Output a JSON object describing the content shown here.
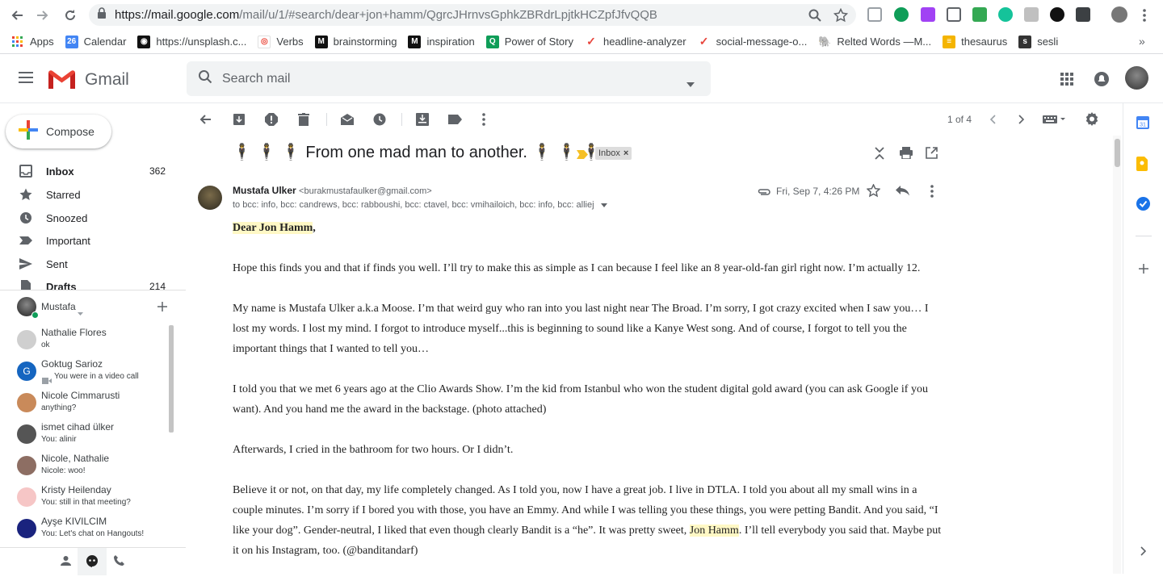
{
  "browser": {
    "url_host": "https://mail.google.com",
    "url_path": "/mail/u/1/#search/dear+jon+hamm/QgrcJHrnvsGphkZBRdrLpjtkHCZpfJfvQQB",
    "bookmarks": [
      {
        "label": "Apps",
        "color": "#ea4335"
      },
      {
        "label": "Calendar",
        "color": "#4285f4"
      },
      {
        "label": "https://unsplash.c...",
        "color": "#111111"
      },
      {
        "label": "Verbs",
        "color": "#ffffff"
      },
      {
        "label": "brainstorming",
        "color": "#111111"
      },
      {
        "label": "inspiration",
        "color": "#111111"
      },
      {
        "label": "Power of Story",
        "color": "#0f9d58"
      },
      {
        "label": "headline-analyzer",
        "color": "#e8453c"
      },
      {
        "label": "social-message-o...",
        "color": "#e8453c"
      },
      {
        "label": "Relted Words —M...",
        "color": "#b5651d"
      },
      {
        "label": "thesaurus",
        "color": "#f4b400"
      },
      {
        "label": "sesli",
        "color": "#333333"
      }
    ],
    "more_label": "»"
  },
  "gmail": {
    "logo_text": "Gmail",
    "search_placeholder": "Search mail"
  },
  "nav": {
    "compose_label": "Compose",
    "items": [
      {
        "label": "Inbox",
        "count": "362",
        "icon": "inbox-icon"
      },
      {
        "label": "Starred",
        "count": "",
        "icon": "star-icon"
      },
      {
        "label": "Snoozed",
        "count": "",
        "icon": "clock-icon"
      },
      {
        "label": "Important",
        "count": "",
        "icon": "important-icon"
      },
      {
        "label": "Sent",
        "count": "",
        "icon": "send-icon"
      },
      {
        "label": "Drafts",
        "count": "214",
        "icon": "draft-icon"
      }
    ]
  },
  "hangouts": {
    "user": "Mustafa",
    "contacts": [
      {
        "name": "Nathalie Flores",
        "snippet": "ok",
        "color": "#cfcfcf"
      },
      {
        "name": "Goktug Sarioz",
        "snippet": "You were in a video call",
        "color": "#1565c0",
        "initial": "G"
      },
      {
        "name": "Nicole Cimmarusti",
        "snippet": "anything?",
        "color": "#c98a5a"
      },
      {
        "name": "ismet cihad ülker",
        "snippet": "You: alinir",
        "color": "#555555"
      },
      {
        "name": "Nicole, Nathalie",
        "snippet": "Nicole: woo!",
        "color": "#8d6e63"
      },
      {
        "name": "Kristy Heilenday",
        "snippet": "You: still in that meeting?",
        "color": "#f6c6c6"
      },
      {
        "name": "Ayşe KIVILCIM",
        "snippet": "You: Let's chat on Hangouts!",
        "color": "#1a237e"
      }
    ]
  },
  "toolbar": {
    "pager": "1 of 4"
  },
  "email": {
    "subject_emoji_left": "🕴 🕴 🕴",
    "subject_text": "From one mad man to another.",
    "subject_emoji_right": "🕴 🕴 🕴",
    "label_chip": "Inbox",
    "label_chip_close": "×",
    "sender_name": "Mustafa Ulker",
    "sender_email": "<burakmustafaulker@gmail.com>",
    "recipients": "to bcc: info, bcc: candrews, bcc: rabboushi, bcc: ctavel, bcc: vmihailoich, bcc: info, bcc: alliej",
    "date": "Fri, Sep 7, 4:26 PM",
    "greeting_hl": "Dear Jon Hamm",
    "greeting_tail": ",",
    "p1": "Hope this finds you and that if finds you well. I’ll try to make this as simple as I can because I feel like an 8 year-old-fan girl right now. I’m actually 12.",
    "p2": "My name is Mustafa Ulker a.k.a Moose. I’m that weird guy who ran into you last night near The Broad. I’m sorry, I got crazy excited when I saw you… I lost my words. I lost my mind.  I forgot to introduce myself...this is beginning to sound like a Kanye West song. And of course, I forgot to tell you the important things that I wanted to tell you…",
    "p3": "I told you that we met 6 years ago at the Clio Awards Show. I’m the kid from Istanbul who won the student digital gold award (you can ask Google if you want). And you hand me the award in the backstage. (photo attached)",
    "p4": "Afterwards, I cried in the bathroom for two hours. Or I didn’t.",
    "p5a": "Believe it or not, on that day, my life completely changed. As I told you, now I have a great job. I live in DTLA. I told you about all my small wins in a couple minutes. I’m sorry if I bored you with those, you have an Emmy. And while I was telling you these things, you were petting Bandit. And you said, “I like your dog”. Gender-neutral, I liked that even though clearly Bandit is a “he”. It was pretty sweet, ",
    "p5hl": "Jon Hamm",
    "p5b": ". I’ll tell everybody you said that. Maybe put it on his Instagram, too. (@banditandarf)"
  },
  "colors": {
    "gmail_red": "#ea4335",
    "highlight": "#fff8c5"
  }
}
